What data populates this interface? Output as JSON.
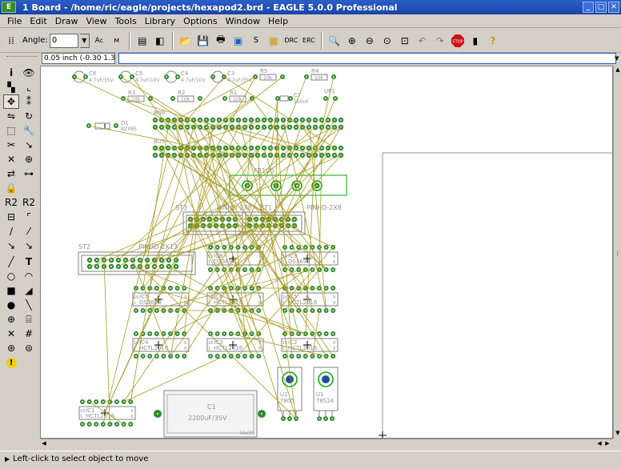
{
  "window": {
    "title": "1 Board - /home/ric/eagle/projects/hexapod2.brd - EAGLE 5.0.0 Professional",
    "app_icon": "E",
    "controls": [
      "minimize-icon",
      "maximize-icon",
      "close-icon"
    ]
  },
  "menu": [
    "File",
    "Edit",
    "Draw",
    "View",
    "Tools",
    "Library",
    "Options",
    "Window",
    "Help"
  ],
  "toolbar": {
    "angle_label": "Angle:",
    "angle_value": "0",
    "buttons": [
      "grid-icon",
      "angle-text-icon",
      "mirror-icon",
      "open-icon",
      "save-icon",
      "print-icon",
      "cam-icon",
      "script-icon",
      "run-ulp-icon",
      "drc-icon",
      "erc-icon",
      "zoom-fit-icon",
      "zoom-in-icon",
      "zoom-out-icon",
      "zoom-redraw-icon",
      "zoom-select-icon",
      "undo-icon",
      "redo-icon",
      "stop-icon",
      "go-icon",
      "help-icon"
    ]
  },
  "coordinates": "0.05 inch (-0.30 1.35)",
  "command_line": "",
  "status_message": "Left-click to select object to move",
  "board": {
    "background": "#ffffff",
    "pad_color": "#2e8b2e",
    "airwire_color": "#a89a20",
    "silk_color": "#808080",
    "name_color": "#909090",
    "highlight_color": "#00aa00",
    "caps_top": [
      {
        "name": "C6",
        "value": "4.7uF/35V"
      },
      {
        "name": "C5",
        "value": "4.7uF/10V"
      },
      {
        "name": "C4",
        "value": "4.7uF/10V"
      },
      {
        "name": "C3",
        "value": "4.7uF/35V"
      }
    ],
    "resistors": [
      {
        "name": "R5",
        "value": "10k"
      },
      {
        "name": "R4",
        "value": "10k"
      },
      {
        "name": "R3",
        "value": "10k"
      },
      {
        "name": "R2",
        "value": "10k"
      },
      {
        "name": "R1",
        "value": "10k"
      }
    ],
    "small_caps": [
      {
        "name": "C7",
        "value": "100nF"
      },
      {
        "name": "UP1",
        "value": ""
      }
    ],
    "diode": {
      "name": "D1",
      "value": "BZX85"
    },
    "buses": [
      "BN6",
      "BU5"
    ],
    "header": {
      "name": "FB100"
    },
    "connectors": [
      {
        "name": "ST3",
        "value": "PINHD-2X8"
      },
      {
        "name": "ST1",
        "value": "PINHD-2X8"
      },
      {
        "name": "ST2",
        "value": "PINHD-2X13"
      }
    ],
    "chips": [
      {
        "name": "IC8",
        "value": "DS3698"
      },
      {
        "name": "IC9",
        "value": "DS3698"
      },
      {
        "name": "IC7",
        "value": "DS3698"
      },
      {
        "name": "IC6",
        "value": "HCTL2016"
      },
      {
        "name": "IC5",
        "value": "HCTL2016"
      },
      {
        "name": "IC4",
        "value": "HCTL2016"
      },
      {
        "name": "IC3",
        "value": "HCTL2016"
      },
      {
        "name": "IC2",
        "value": "HCTL2016"
      },
      {
        "name": "IC1",
        "value": "HCTL2016"
      }
    ],
    "big_cap": {
      "name": "C1",
      "value": "2200uF/35V",
      "size": "16x30"
    },
    "regulators": [
      {
        "name": "U2",
        "value": "7805"
      },
      {
        "name": "U1",
        "value": "78S24"
      }
    ],
    "pin_labels": [
      "16",
      "1",
      "9",
      "8"
    ]
  }
}
